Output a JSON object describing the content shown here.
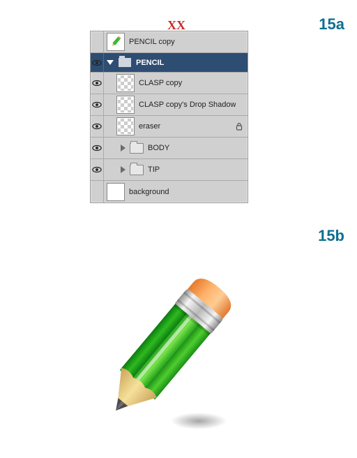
{
  "figure_labels": {
    "a": "15a",
    "b": "15b"
  },
  "annotation": "XX",
  "panel": {
    "rows": [
      {
        "id": "pencil-copy",
        "label": "PENCIL copy",
        "visible": false,
        "indent": 0,
        "kind": "layer",
        "thumb": "pencil"
      },
      {
        "id": "pencil-group",
        "label": "PENCIL",
        "visible": true,
        "indent": 0,
        "kind": "group",
        "expanded": true,
        "selected": true
      },
      {
        "id": "clasp-copy",
        "label": "CLASP copy",
        "visible": true,
        "indent": 1,
        "kind": "layer",
        "thumb": "trans"
      },
      {
        "id": "clasp-shadow",
        "label": "CLASP copy's Drop Shadow",
        "visible": true,
        "indent": 1,
        "kind": "layer",
        "thumb": "trans"
      },
      {
        "id": "eraser",
        "label": "eraser",
        "visible": true,
        "indent": 1,
        "kind": "layer",
        "thumb": "trans",
        "locked": true
      },
      {
        "id": "body-group",
        "label": "BODY",
        "visible": true,
        "indent": 1,
        "kind": "group",
        "expanded": false
      },
      {
        "id": "tip-group",
        "label": "TIP",
        "visible": true,
        "indent": 1,
        "kind": "group",
        "expanded": false
      },
      {
        "id": "background",
        "label": "background",
        "visible": false,
        "indent": 0,
        "kind": "layer",
        "thumb": "white"
      }
    ]
  }
}
